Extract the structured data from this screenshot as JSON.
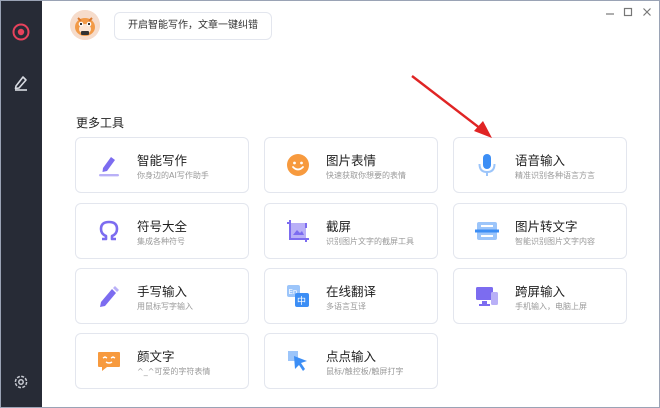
{
  "header": {
    "promo_text": "开启智能写作，文章一键纠错"
  },
  "section": {
    "title": "更多工具"
  },
  "tools": [
    {
      "title": "智能写作",
      "desc": "你身边的AI写作助手"
    },
    {
      "title": "图片表情",
      "desc": "快速获取你想要的表情"
    },
    {
      "title": "语音输入",
      "desc": "精准识别各种语言方言"
    },
    {
      "title": "符号大全",
      "desc": "集成各种符号"
    },
    {
      "title": "截屏",
      "desc": "识别图片文字的截屏工具"
    },
    {
      "title": "图片转文字",
      "desc": "智能识别图片文字内容"
    },
    {
      "title": "手写输入",
      "desc": "用鼠标写字输入"
    },
    {
      "title": "在线翻译",
      "desc": "多语言互译"
    },
    {
      "title": "跨屏输入",
      "desc": "手机输入，电脑上屏"
    },
    {
      "title": "颜文字",
      "desc": "^_^可爱的字符表情"
    },
    {
      "title": "点点输入",
      "desc": "鼠标/触控板/触屏打字"
    }
  ],
  "colors": {
    "sidebar": "#272b36",
    "accent_purple": "#7c6cf0",
    "accent_orange": "#f79a3e",
    "accent_blue": "#3c8ef5",
    "arrow": "#e02424"
  },
  "icons": {
    "nav_home": "target-icon",
    "nav_write": "pen-icon",
    "nav_settings": "gear-icon"
  }
}
